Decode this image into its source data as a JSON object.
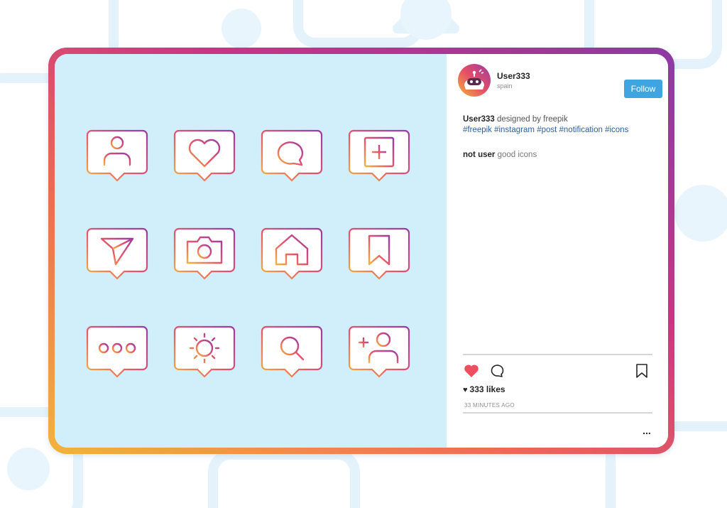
{
  "colors": {
    "frame_gradient": [
      "#f3b33c",
      "#ec6a55",
      "#c73584",
      "#8c3aa3"
    ],
    "image_background": "#d1eefb",
    "follow_button": "#3fa5e0",
    "like_heart": "#ef4e5e",
    "hashtag": "#2b5f9e"
  },
  "image": {
    "icons": [
      "user-icon",
      "heart-icon",
      "comment-icon",
      "add-post-icon",
      "send-icon",
      "camera-icon",
      "home-icon",
      "bookmark-icon",
      "more-dots-icon",
      "brightness-icon",
      "search-icon",
      "add-user-icon"
    ]
  },
  "post": {
    "username": "User333",
    "location": "spain",
    "follow_label": "Follow",
    "caption": {
      "username": "User333",
      "text": " designed by freepik",
      "hashtags": "#freepik #instagram #post #notification #icons"
    },
    "comment": {
      "username": "not user",
      "text": " good icons"
    },
    "likes": "333 likes",
    "likes_icon": "♥",
    "time": "33 MINUTES AGO",
    "more": "..."
  }
}
